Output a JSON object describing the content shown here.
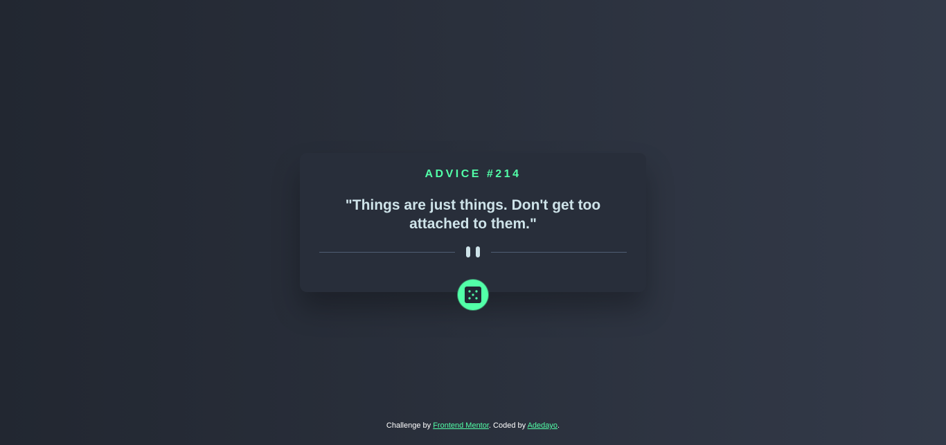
{
  "advice": {
    "label": "ADVICE #214",
    "quote": "\"Things are just things. Don't get too attached to them.\""
  },
  "icons": {
    "divider": "pause-icon",
    "button": "dice-icon"
  },
  "footer": {
    "prefix": "Challenge by ",
    "challenge_link": "Frontend Mentor",
    "middle": ". Coded by ",
    "author_link": "Adedayo",
    "suffix": "."
  },
  "colors": {
    "accent": "#52ffa8",
    "card": "#282e3a",
    "text": "#cee3e9",
    "divider": "#4f5d74",
    "background": "#222731"
  }
}
